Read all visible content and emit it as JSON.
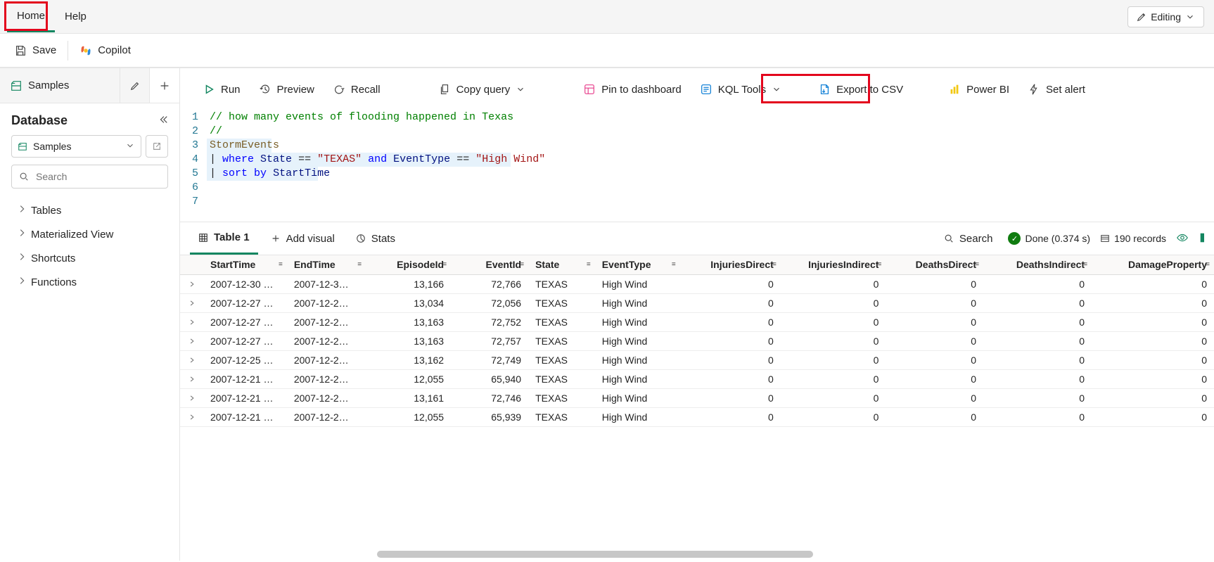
{
  "ribbon": {
    "tabs": {
      "home": "Home",
      "help": "Help"
    },
    "editing_label": "Editing"
  },
  "actions": {
    "save": "Save",
    "copilot": "Copilot"
  },
  "sidebar": {
    "tab_label": "Samples",
    "title": "Database",
    "select_value": "Samples",
    "search_placeholder": "Search",
    "tree": {
      "tables": "Tables",
      "matviews": "Materialized View",
      "shortcuts": "Shortcuts",
      "functions": "Functions"
    }
  },
  "toolbar": {
    "run": "Run",
    "preview": "Preview",
    "recall": "Recall",
    "copy_query": "Copy query",
    "pin": "Pin to dashboard",
    "kql_tools": "KQL Tools",
    "export_csv": "Export to CSV",
    "powerbi": "Power BI",
    "set_alert": "Set alert"
  },
  "editor": {
    "lines": [
      {
        "n": 1,
        "tokens": [
          [
            "c-comment",
            "// how many events of flooding happened in Texas"
          ]
        ]
      },
      {
        "n": 2,
        "tokens": [
          [
            "c-comment",
            "//"
          ]
        ]
      },
      {
        "n": 3,
        "tokens": [
          [
            "c-ident-table",
            "StormEvents"
          ]
        ]
      },
      {
        "n": 4,
        "tokens": [
          [
            "c-pipe",
            "| "
          ],
          [
            "c-keyword",
            "where"
          ],
          [
            "",
            " "
          ],
          [
            "c-ident",
            "State"
          ],
          [
            "",
            " "
          ],
          [
            "c-op",
            "=="
          ],
          [
            "",
            " "
          ],
          [
            "c-string",
            "\"TEXAS\""
          ],
          [
            "",
            " "
          ],
          [
            "c-and",
            "and"
          ],
          [
            "",
            " "
          ],
          [
            "c-ident",
            "EventType"
          ],
          [
            "",
            " "
          ],
          [
            "c-op",
            "=="
          ],
          [
            "",
            " "
          ],
          [
            "c-string",
            "\"High Wind\""
          ]
        ]
      },
      {
        "n": 5,
        "tokens": [
          [
            "c-pipe",
            "| "
          ],
          [
            "c-keyword",
            "sort"
          ],
          [
            "",
            " "
          ],
          [
            "c-keyword",
            "by"
          ],
          [
            "",
            " "
          ],
          [
            "c-ident",
            "StartTime"
          ]
        ]
      },
      {
        "n": 6,
        "tokens": []
      },
      {
        "n": 7,
        "tokens": []
      }
    ]
  },
  "results": {
    "tabs": {
      "table": "Table 1",
      "add_visual": "Add visual",
      "stats": "Stats"
    },
    "search": "Search",
    "status_done": "Done (0.374 s)",
    "records": "190 records",
    "columns": [
      "StartTime",
      "EndTime",
      "EpisodeId",
      "EventId",
      "State",
      "EventType",
      "InjuriesDirect",
      "InjuriesIndirect",
      "DeathsDirect",
      "DeathsIndirect",
      "DamageProperty"
    ],
    "num_cols": [
      2,
      3,
      6,
      7,
      8,
      9,
      10
    ],
    "rows": [
      [
        "2007-12-30 …",
        "2007-12-3…",
        "13,166",
        "72,766",
        "TEXAS",
        "High Wind",
        "0",
        "0",
        "0",
        "0",
        "0"
      ],
      [
        "2007-12-27 …",
        "2007-12-2…",
        "13,034",
        "72,056",
        "TEXAS",
        "High Wind",
        "0",
        "0",
        "0",
        "0",
        "0"
      ],
      [
        "2007-12-27 …",
        "2007-12-2…",
        "13,163",
        "72,752",
        "TEXAS",
        "High Wind",
        "0",
        "0",
        "0",
        "0",
        "0"
      ],
      [
        "2007-12-27 …",
        "2007-12-2…",
        "13,163",
        "72,757",
        "TEXAS",
        "High Wind",
        "0",
        "0",
        "0",
        "0",
        "0"
      ],
      [
        "2007-12-25 …",
        "2007-12-2…",
        "13,162",
        "72,749",
        "TEXAS",
        "High Wind",
        "0",
        "0",
        "0",
        "0",
        "0"
      ],
      [
        "2007-12-21 …",
        "2007-12-2…",
        "12,055",
        "65,940",
        "TEXAS",
        "High Wind",
        "0",
        "0",
        "0",
        "0",
        "0"
      ],
      [
        "2007-12-21 …",
        "2007-12-2…",
        "13,161",
        "72,746",
        "TEXAS",
        "High Wind",
        "0",
        "0",
        "0",
        "0",
        "0"
      ],
      [
        "2007-12-21 …",
        "2007-12-2…",
        "12,055",
        "65,939",
        "TEXAS",
        "High Wind",
        "0",
        "0",
        "0",
        "0",
        "0"
      ]
    ]
  }
}
